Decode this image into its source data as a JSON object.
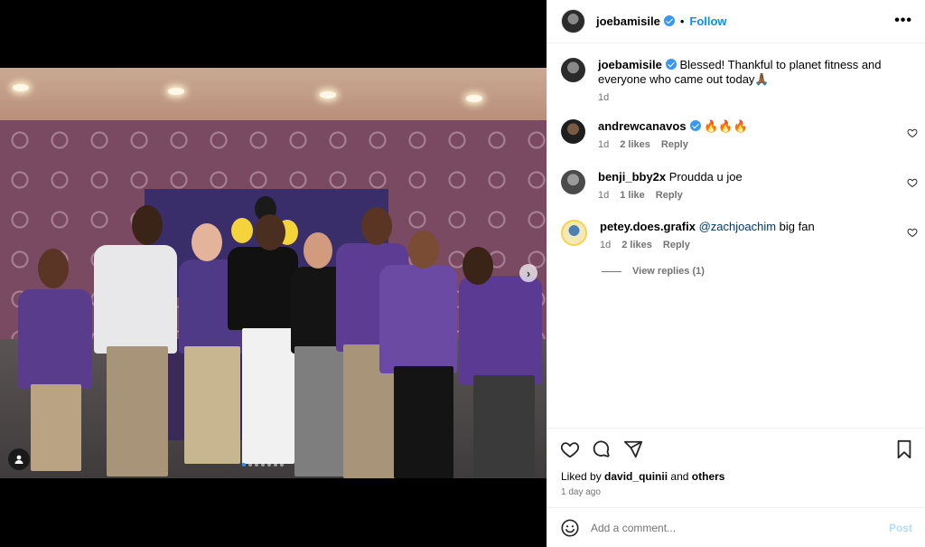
{
  "post": {
    "author": "joebamisile",
    "follow_label": "Follow",
    "dot_sep": "•",
    "more_label": "•••",
    "caption": "Blessed! Thankful to planet fitness and everyone who came out today🙏🏾",
    "caption_time": "1d"
  },
  "comments": [
    {
      "user": "andrewcanavos",
      "verified": true,
      "text": "🔥🔥🔥",
      "time": "1d",
      "likes": "2 likes",
      "reply": "Reply"
    },
    {
      "user": "benji_bby2x",
      "verified": false,
      "text": "Proudda u joe",
      "time": "1d",
      "likes": "1 like",
      "reply": "Reply"
    },
    {
      "user": "petey.does.grafix",
      "verified": false,
      "mention": "@zachjoachim",
      "text": "big fan",
      "time": "1d",
      "likes": "2 likes",
      "reply": "Reply"
    }
  ],
  "view_replies": "View replies (1)",
  "actions": {
    "liked_prefix": "Liked by",
    "liked_user": "david_quinii",
    "liked_and": "and",
    "liked_others": "others",
    "posted_ago": "1 day ago"
  },
  "composer": {
    "placeholder": "Add a comment...",
    "post_label": "Post"
  },
  "media": {
    "next_icon": "›",
    "carousel_dots": 7,
    "active_dot": 0
  },
  "colors": {
    "link": "#0095f6",
    "verified": "#3897f0",
    "muted": "#737373"
  }
}
